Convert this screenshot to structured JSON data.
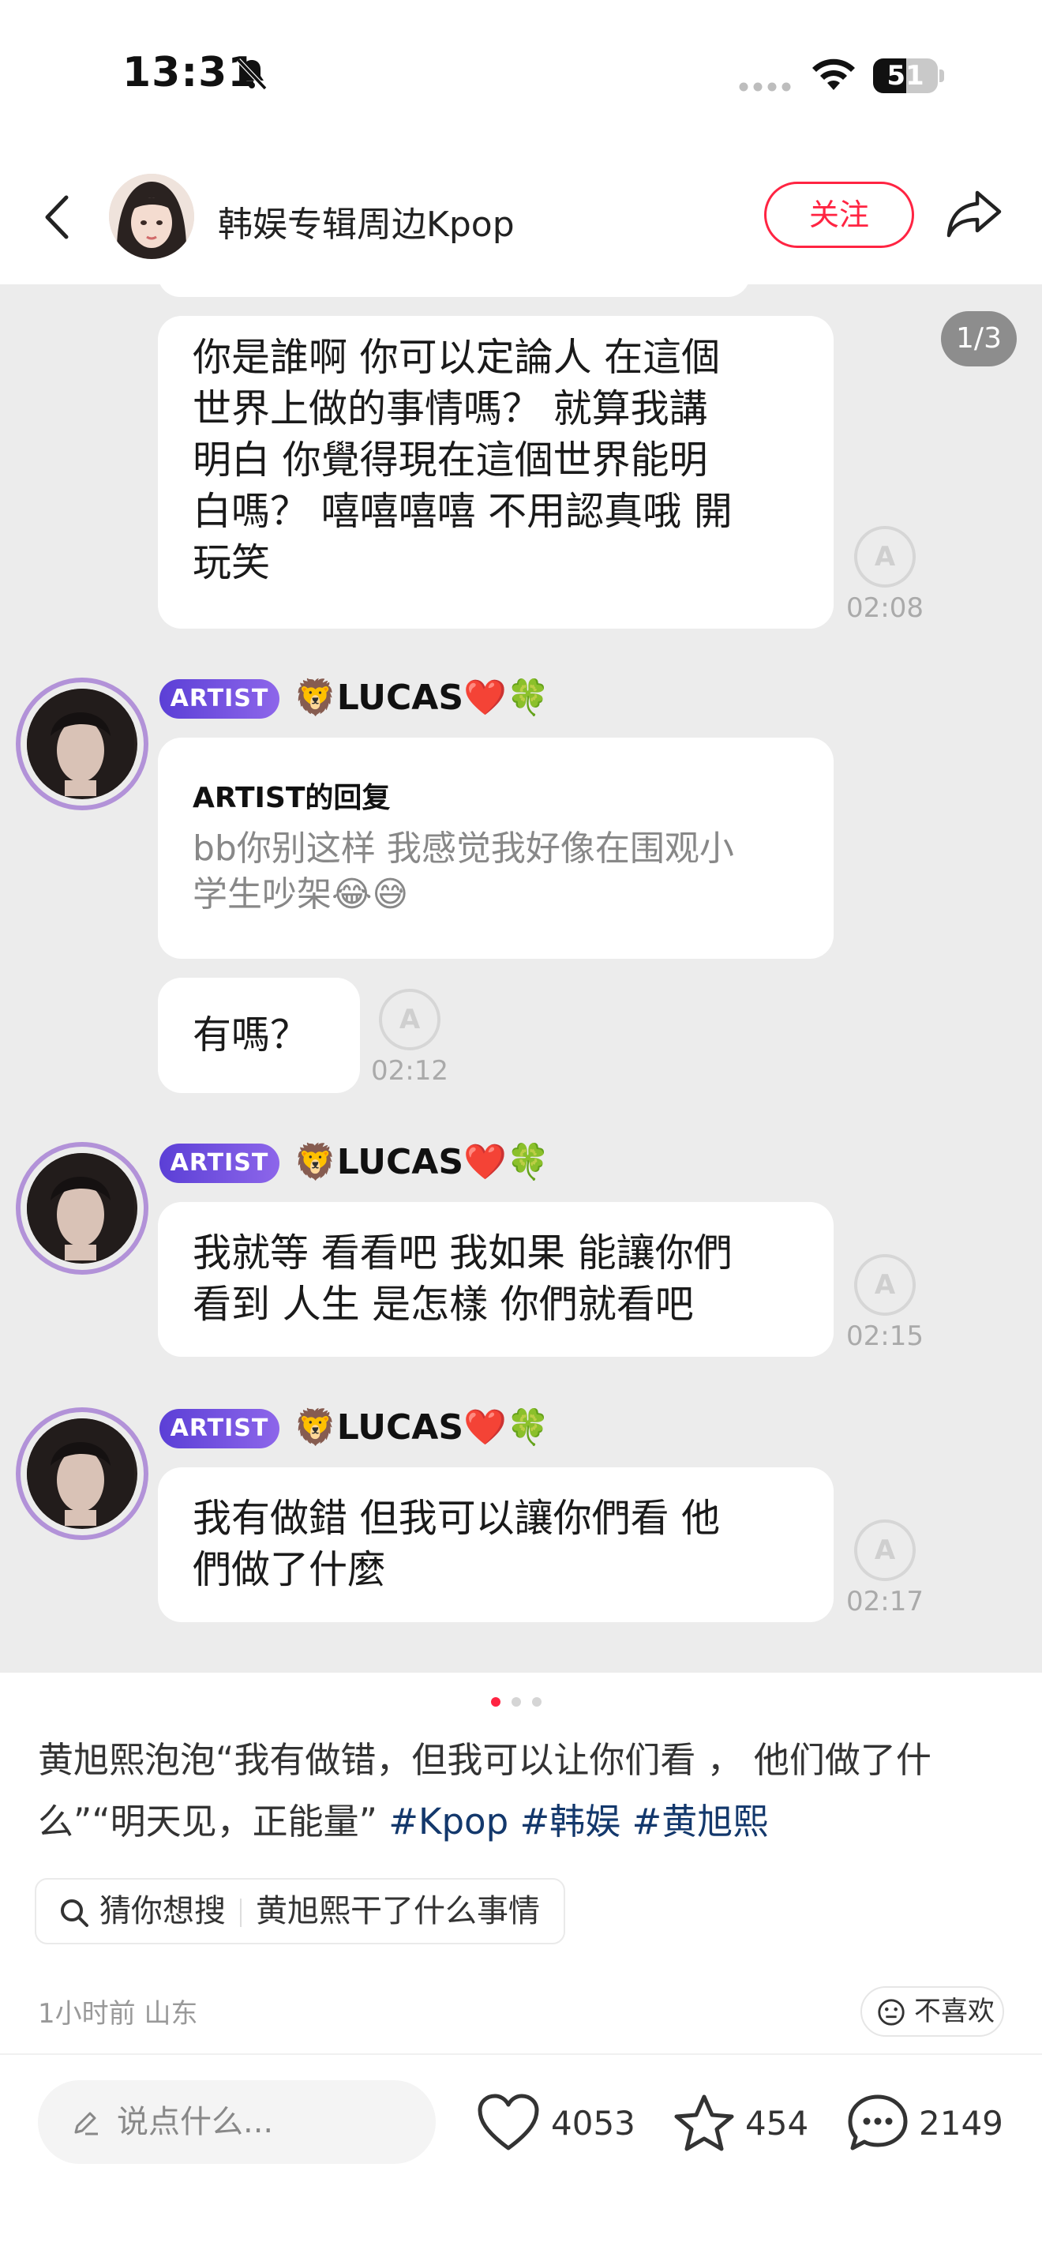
{
  "status_bar": {
    "time": "13:31",
    "battery": "51",
    "battery_level": 0.51
  },
  "header": {
    "author": "韩娱专辑周边Kpop",
    "follow_label": "关注"
  },
  "image": {
    "pager": "1/3",
    "messages": [
      {
        "text_lines": [
          "你是誰啊 你可以定論人 在這個",
          "世界上做的事情嗎？ 就算我講",
          "明白 你覺得現在這個世界能明",
          "白嗎？ 嘻嘻嘻嘻 不用認真哦 開",
          "玩笑"
        ],
        "time": "02:08"
      },
      {
        "badge": "ARTIST",
        "name": "🦁LUCAS❤️🍀",
        "reply_title": "ARTIST的回复",
        "reply_lines": [
          "bb你别这样 我感觉我好像在围观小",
          "学生吵架😂😅"
        ]
      },
      {
        "text_lines": [
          "有嗎？"
        ],
        "time": "02:12"
      },
      {
        "badge": "ARTIST",
        "name": "🦁LUCAS❤️🍀",
        "text_lines": [
          "我就等 看看吧 我如果 能讓你們",
          "看到 人生 是怎樣 你們就看吧"
        ],
        "time": "02:15"
      },
      {
        "badge": "ARTIST",
        "name": "🦁LUCAS❤️🍀",
        "text_lines": [
          "我有做錯 但我可以讓你們看 他",
          "們做了什麼"
        ],
        "time": "02:17"
      }
    ],
    "stamp_letter": "A"
  },
  "caption": {
    "line1": "黄旭熙泡泡“我有做错，但我可以让你们看 ， 他们做了什",
    "line2": "么”“明天见，正能量”",
    "tags": [
      "#Kpop",
      "#韩娱",
      "#黄旭熙"
    ]
  },
  "suggest": {
    "label": "猜你想搜",
    "query": "黄旭熙干了什么事情"
  },
  "meta": {
    "time_location": "1小时前 山东",
    "dislike_label": "不喜欢"
  },
  "bottom_bar": {
    "comment_placeholder": "说点什么...",
    "likes": "4053",
    "collects": "454",
    "comments": "2149"
  },
  "colors": {
    "accent": "#ff2442",
    "tag": "#13386c",
    "badge": "#6a4be0",
    "avatar_ring": "#b292d8"
  }
}
